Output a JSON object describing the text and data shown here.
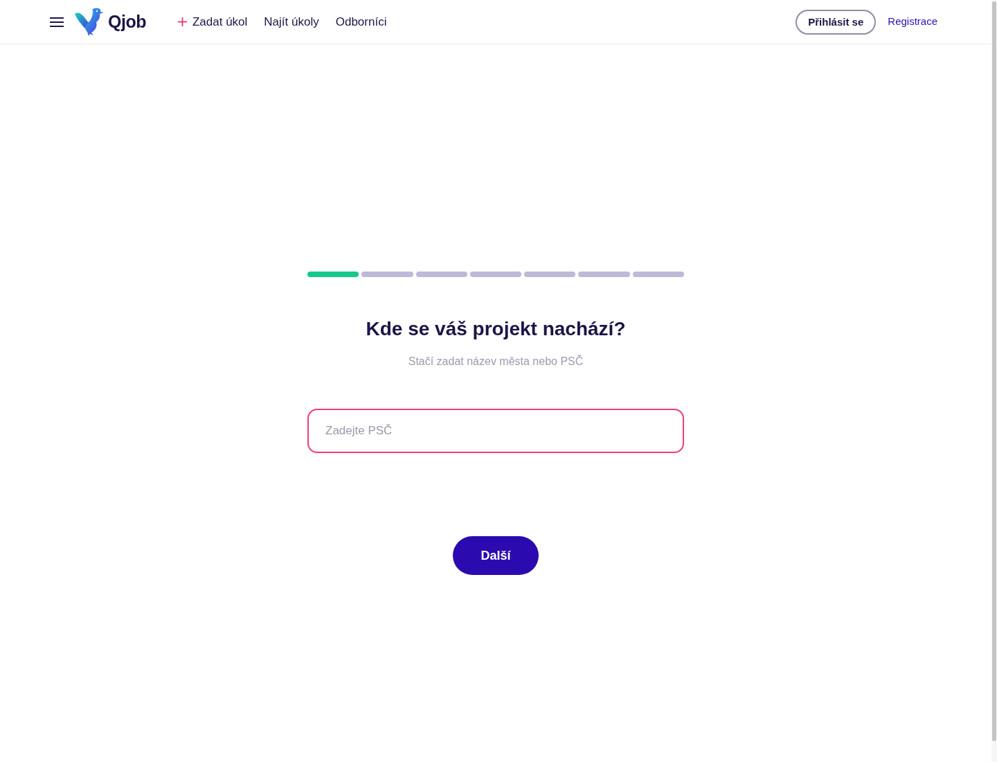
{
  "header": {
    "logo": {
      "text": "Qjob"
    },
    "nav": [
      {
        "label": "Zadat úkol",
        "kind": "add"
      },
      {
        "label": "Najít úkoly",
        "kind": "plain"
      },
      {
        "label": "Odborníci",
        "kind": "plain"
      }
    ],
    "login_button": "Přihlásit se",
    "register_link": "Registrace"
  },
  "progress": {
    "steps": [
      {
        "completed": true
      },
      {
        "completed": false
      },
      {
        "completed": false
      },
      {
        "completed": false
      },
      {
        "completed": false
      },
      {
        "completed": false
      },
      {
        "completed": false
      }
    ]
  },
  "form": {
    "title": "Kde se váš projekt nachází?",
    "subtitle": "Stačí zadat název města nebo PSČ",
    "zip_field": {
      "placeholder": "Zadejte PSČ",
      "focused": true
    },
    "next_button": "Další"
  }
}
